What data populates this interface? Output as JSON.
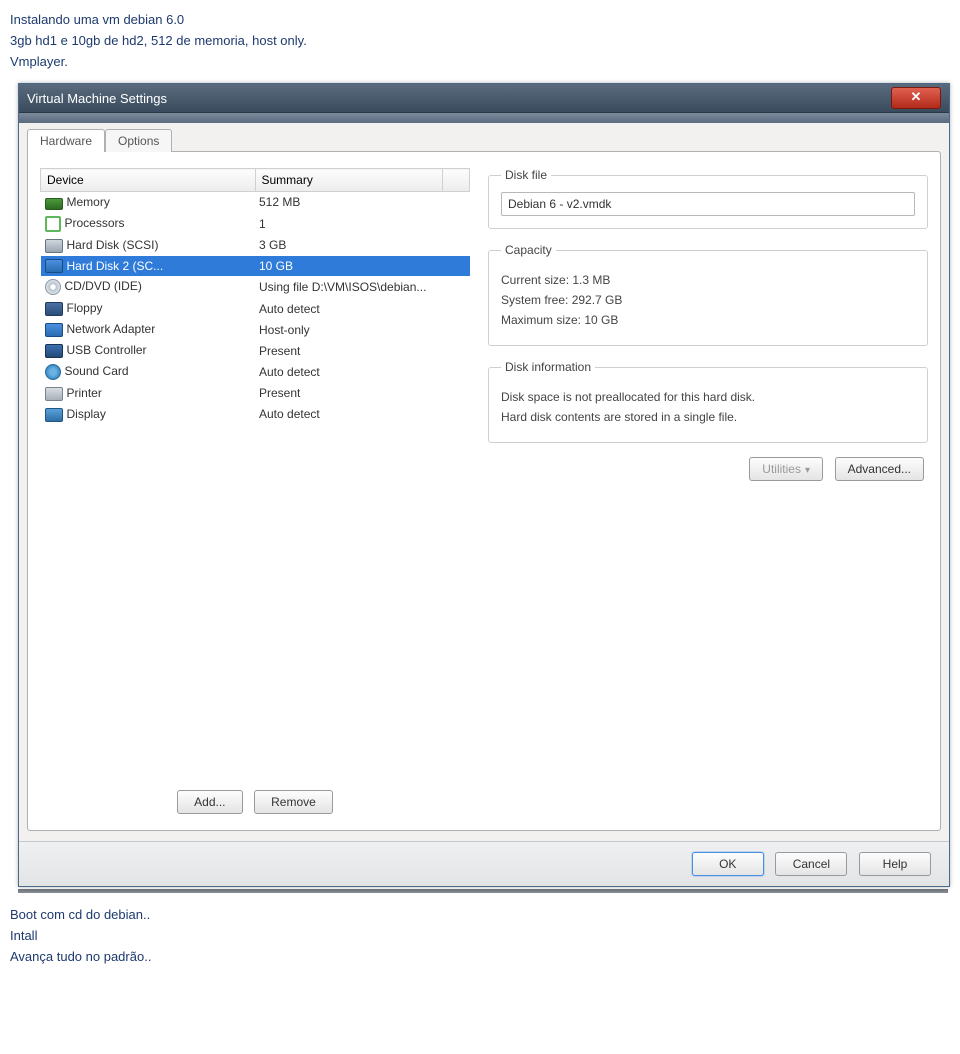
{
  "doc": {
    "line1": "Instalando uma vm debian 6.0",
    "line2": "3gb hd1 e 10gb de hd2, 512 de memoria, host only.",
    "line3": "Vmplayer.",
    "line4": "Boot com cd do debian..",
    "line5": "Intall",
    "line6": "Avança tudo no padrão.."
  },
  "window": {
    "title": "Virtual Machine Settings",
    "close_glyph": "✕"
  },
  "tabs": {
    "hardware": "Hardware",
    "options": "Options"
  },
  "table": {
    "col_device": "Device",
    "col_summary": "Summary",
    "rows": [
      {
        "icon": "ic-memory",
        "name": "Memory",
        "summary": "512 MB"
      },
      {
        "icon": "ic-cpu",
        "name": "Processors",
        "summary": "1"
      },
      {
        "icon": "ic-hd",
        "name": "Hard Disk (SCSI)",
        "summary": "3 GB"
      },
      {
        "icon": "ic-hd-sel",
        "name": "Hard Disk 2 (SC...",
        "summary": "10 GB",
        "selected": true
      },
      {
        "icon": "ic-cd",
        "name": "CD/DVD (IDE)",
        "summary": "Using file D:\\VM\\ISOS\\debian..."
      },
      {
        "icon": "ic-floppy",
        "name": "Floppy",
        "summary": "Auto detect"
      },
      {
        "icon": "ic-net",
        "name": "Network Adapter",
        "summary": "Host-only"
      },
      {
        "icon": "ic-usb",
        "name": "USB Controller",
        "summary": "Present"
      },
      {
        "icon": "ic-sound",
        "name": "Sound Card",
        "summary": "Auto detect"
      },
      {
        "icon": "ic-print",
        "name": "Printer",
        "summary": "Present"
      },
      {
        "icon": "ic-disp",
        "name": "Display",
        "summary": "Auto detect"
      }
    ]
  },
  "left_buttons": {
    "add": "Add...",
    "remove": "Remove"
  },
  "right": {
    "disk_file": {
      "legend": "Disk file",
      "value": "Debian 6 - v2.vmdk"
    },
    "capacity": {
      "legend": "Capacity",
      "current": "Current size: 1.3 MB",
      "free": "System free: 292.7 GB",
      "max": "Maximum size: 10 GB"
    },
    "info": {
      "legend": "Disk information",
      "l1": "Disk space is not preallocated for this hard disk.",
      "l2": "Hard disk contents are stored in a single file."
    },
    "utilities": "Utilities",
    "advanced": "Advanced..."
  },
  "dlg": {
    "ok": "OK",
    "cancel": "Cancel",
    "help": "Help"
  }
}
